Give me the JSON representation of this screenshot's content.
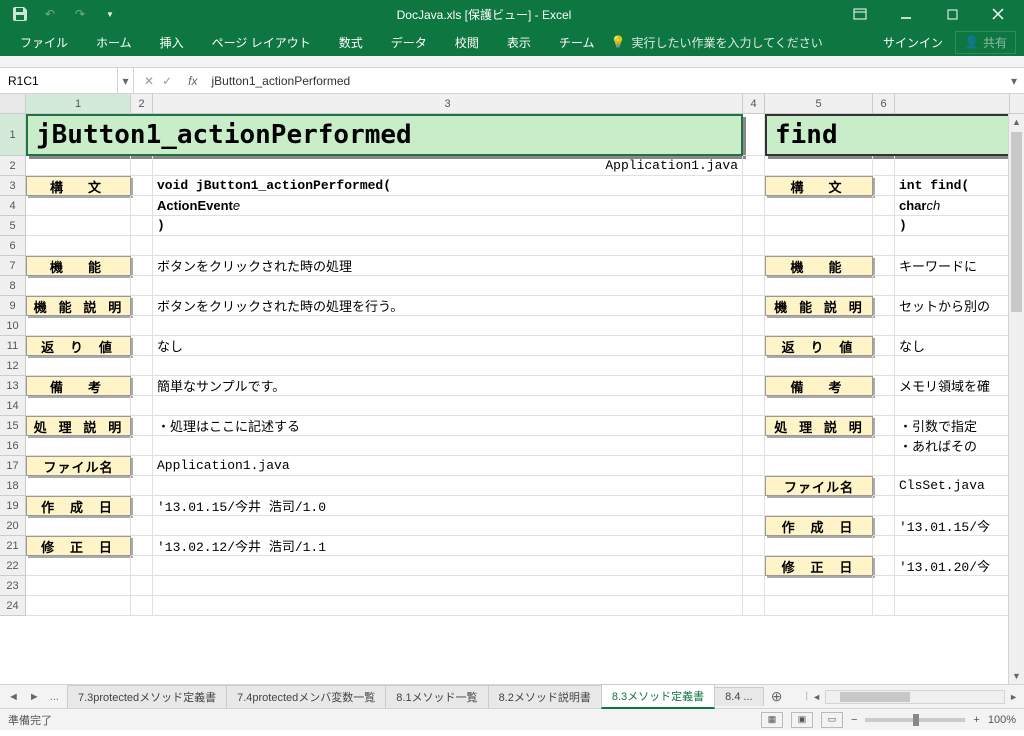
{
  "title": {
    "doc": "DocJava.xls",
    "view": "[保護ビュー]",
    "app": "- Excel"
  },
  "qat": {
    "save": "💾"
  },
  "ribbon": {
    "tabs": [
      "ファイル",
      "ホーム",
      "挿入",
      "ページ レイアウト",
      "数式",
      "データ",
      "校閲",
      "表示",
      "チーム"
    ],
    "tellme": "実行したい作業を入力してください",
    "signin": "サインイン",
    "share": "共有"
  },
  "namebox": "R1C1",
  "formula": "jButton1_actionPerformed",
  "cols": [
    "1",
    "2",
    "3",
    "4",
    "5",
    "6"
  ],
  "rows": [
    "1",
    "2",
    "3",
    "4",
    "5",
    "6",
    "7",
    "8",
    "9",
    "10",
    "11",
    "12",
    "13",
    "14",
    "15",
    "16",
    "17",
    "18",
    "19",
    "20",
    "21",
    "22",
    "23",
    "24"
  ],
  "cells": {
    "r1c1_title": "jButton1_actionPerformed",
    "r1c5_title": "find",
    "r2c3": "Application1.java",
    "label_kobun": "構　文",
    "label_kinou": "機　能",
    "label_kinou_setsumei": "機 能 説 明",
    "label_kaerichi": "返 り 値",
    "label_bikou": "備　考",
    "label_shori": "処 理 説 明",
    "label_file": "ファイル名",
    "label_sakusei": "作 成 日",
    "label_shusei": "修 正 日",
    "r3c3": "void jButton1_actionPerformed(",
    "r4c3": "  ActionEvent",
    "r4c3_italic": " e",
    "r5c3": ")",
    "r3c7": "int find(",
    "r4c7": "  char",
    "r4c7_italic": " ch",
    "r5c7": ")",
    "r7c3": "ボタンをクリックされた時の処理",
    "r7c7": "キーワードに",
    "r9c3": "ボタンをクリックされた時の処理を行う。",
    "r9c7": "セットから別の",
    "r11c3": "なし",
    "r11c7": "なし",
    "r13c3": "簡単なサンプルです。",
    "r13c7": "メモリ領域を確",
    "r15c3": "・処理はここに記述する",
    "r15c7": "・引数で指定",
    "r16c7": "・あればその",
    "r17c3": "Application1.java",
    "r18c7": "ClsSet.java",
    "r19c3": "'13.01.15/今井 浩司/1.0",
    "r20c7": "'13.01.15/今",
    "r21c3": "'13.02.12/今井 浩司/1.1",
    "r22c7": "'13.01.20/今"
  },
  "sheets": {
    "nav_more": "...",
    "tabs": [
      "7.3protectedメソッド定義書",
      "7.4protectedメンバ変数一覧",
      "8.1メソッド一覧",
      "8.2メソッド説明書",
      "8.3メソッド定義書",
      "8.4 ..."
    ],
    "active": 4
  },
  "status": {
    "ready": "準備完了",
    "zoom": "100%"
  }
}
